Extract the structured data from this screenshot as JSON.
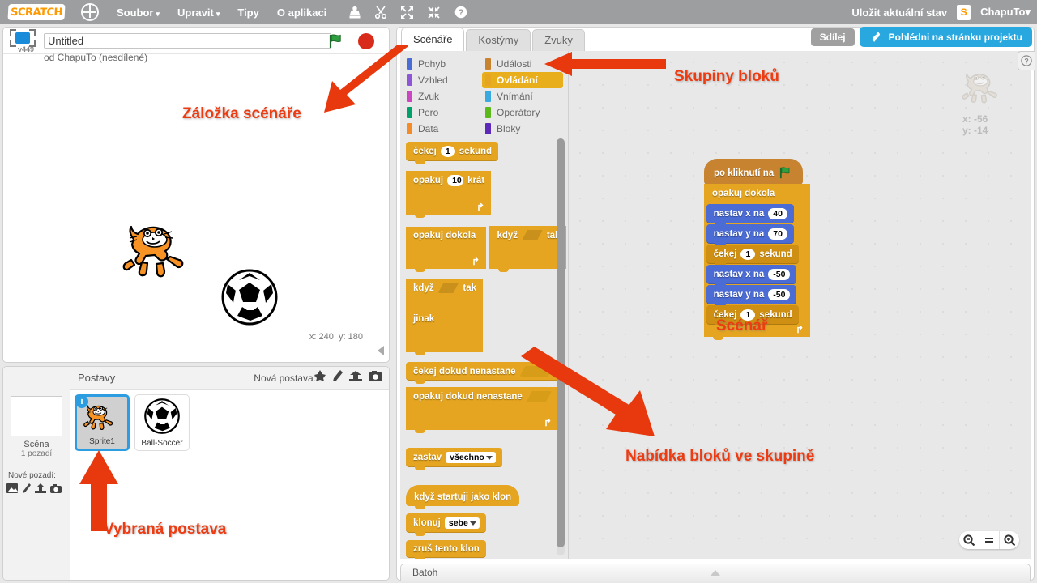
{
  "menubar": {
    "logo": "SCRATCH",
    "globe_icon": "globe-icon",
    "items": [
      {
        "label": "Soubor",
        "caret": "▾"
      },
      {
        "label": "Upravit",
        "caret": "▾"
      },
      {
        "label": "Tipy",
        "caret": ""
      },
      {
        "label": "O aplikaci",
        "caret": ""
      }
    ],
    "tool_icons": [
      "stamp-icon",
      "scissors-icon",
      "grow-icon",
      "shrink-icon",
      "help-icon"
    ],
    "save_label": "Uložit aktuální stav",
    "account_icon": "backpack-icon",
    "username": "ChapuTo",
    "username_caret": "▾"
  },
  "stage": {
    "version": "v449",
    "project_title_value": "Untitled",
    "project_title_placeholder": "Untitled",
    "byline": "od ChapuTo (nesdílené)",
    "green_flag": "green-flag-icon",
    "stop_button": "stop-icon",
    "coords_x_label": "x:",
    "coords_x_value": "240",
    "coords_y_label": "y:",
    "coords_y_value": "180"
  },
  "share": {
    "share_label": "Sdílej",
    "project_page_label": "Pohlédni na stránku projektu",
    "project_page_icon": "see-inside-icon"
  },
  "sprite_pane": {
    "header": "Postavy",
    "new_sprite_label": "Nová postava:",
    "new_sprite_icons": [
      "surprise-icon",
      "paint-icon",
      "upload-icon",
      "camera-icon"
    ],
    "stage_label": "Scéna",
    "stage_sublabel": "1 pozadí",
    "new_backdrop_label": "Nové pozadí:",
    "new_backdrop_icons": [
      "library-icon",
      "paint-icon",
      "upload-icon",
      "camera-icon"
    ],
    "sprites": [
      {
        "name": "Sprite1",
        "selected": true,
        "info_badge": "i",
        "thumb": "cat"
      },
      {
        "name": "Ball-Soccer",
        "selected": false,
        "info_badge": "",
        "thumb": "ball"
      }
    ]
  },
  "editor": {
    "tabs": [
      {
        "label": "Scénáře",
        "active": true
      },
      {
        "label": "Kostýmy",
        "active": false
      },
      {
        "label": "Zvuky",
        "active": false
      }
    ],
    "categories": [
      {
        "label": "Pohyb",
        "color": "#4b6cd4",
        "active": false,
        "col": 0,
        "row": 0
      },
      {
        "label": "Vzhled",
        "color": "#8e55d6",
        "active": false,
        "col": 0,
        "row": 1
      },
      {
        "label": "Zvuk",
        "color": "#ca47c1",
        "active": false,
        "col": 0,
        "row": 2
      },
      {
        "label": "Pero",
        "color": "#00a06a",
        "active": false,
        "col": 0,
        "row": 3
      },
      {
        "label": "Data",
        "color": "#f28b28",
        "active": false,
        "col": 0,
        "row": 4
      },
      {
        "label": "Události",
        "color": "#c88330",
        "active": false,
        "col": 1,
        "row": 0
      },
      {
        "label": "Ovládání",
        "color": "#e5a520",
        "active": true,
        "col": 1,
        "row": 1
      },
      {
        "label": "Vnímání",
        "color": "#39a9e0",
        "active": false,
        "col": 1,
        "row": 2
      },
      {
        "label": "Operátory",
        "color": "#5cb91b",
        "active": false,
        "col": 1,
        "row": 3
      },
      {
        "label": "Bloky",
        "color": "#5c29b8",
        "active": false,
        "col": 1,
        "row": 4
      }
    ],
    "palette_blocks": [
      {
        "type": "stack",
        "parts": [
          {
            "t": "text",
            "v": "čekej"
          },
          {
            "t": "num",
            "v": "1"
          },
          {
            "t": "text",
            "v": "sekund"
          }
        ]
      },
      {
        "type": "c",
        "parts": [
          {
            "t": "text",
            "v": "opakuj"
          },
          {
            "t": "num",
            "v": "10"
          },
          {
            "t": "text",
            "v": "krát"
          }
        ],
        "loop_arrow": true
      },
      {
        "type": "c",
        "parts": [
          {
            "t": "text",
            "v": "opakuj dokola"
          }
        ],
        "loop_arrow": true
      },
      {
        "type": "c",
        "parts": [
          {
            "t": "text",
            "v": "když"
          },
          {
            "t": "hex",
            "v": ""
          },
          {
            "t": "text",
            "v": "tak"
          }
        ],
        "loop_arrow": false
      },
      {
        "type": "ifelse",
        "parts": [
          {
            "t": "text",
            "v": "když"
          },
          {
            "t": "hex",
            "v": ""
          },
          {
            "t": "text",
            "v": "tak"
          }
        ],
        "else_label": "jinak"
      },
      {
        "type": "stack",
        "parts": [
          {
            "t": "text",
            "v": "čekej dokud nenastane"
          },
          {
            "t": "hexlite",
            "v": ""
          }
        ]
      },
      {
        "type": "c",
        "parts": [
          {
            "t": "text",
            "v": "opakuj dokud nenastane"
          },
          {
            "t": "hexlite",
            "v": ""
          }
        ],
        "loop_arrow": true
      },
      {
        "type": "stack",
        "parts": [
          {
            "t": "text",
            "v": "zastav"
          },
          {
            "t": "drop",
            "v": "všechno"
          }
        ],
        "capped": true
      },
      {
        "type": "hat",
        "parts": [
          {
            "t": "text",
            "v": "když startuji jako klon"
          }
        ]
      },
      {
        "type": "stack",
        "parts": [
          {
            "t": "text",
            "v": "klonuj"
          },
          {
            "t": "drop",
            "v": "sebe"
          }
        ]
      },
      {
        "type": "stack",
        "parts": [
          {
            "t": "text",
            "v": "zruš tento klon"
          }
        ],
        "capped": true
      }
    ],
    "script": {
      "hat": {
        "label": "po kliknutí na",
        "icon": "green-flag-icon"
      },
      "loop_label": "opakuj dokola",
      "body": [
        {
          "kind": "motion",
          "label": "nastav x na",
          "value": "40"
        },
        {
          "kind": "motion",
          "label": "nastav y na",
          "value": "70"
        },
        {
          "kind": "control",
          "label_pre": "čekej",
          "value": "1",
          "label_post": "sekund"
        },
        {
          "kind": "motion",
          "label": "nastav x na",
          "value": "-50"
        },
        {
          "kind": "motion",
          "label": "nastav y na",
          "value": "-50"
        },
        {
          "kind": "control",
          "label_pre": "čekej",
          "value": "1",
          "label_post": "sekund"
        }
      ]
    },
    "watermark": {
      "x_label": "x:",
      "x_value": "-56",
      "y_label": "y:",
      "y_value": "-14"
    },
    "zoom_controls": [
      {
        "icon": "zoom-out-icon",
        "glyph": "⊖"
      },
      {
        "icon": "zoom-reset-icon",
        "glyph": "="
      },
      {
        "icon": "zoom-in-icon",
        "glyph": "⊕"
      }
    ],
    "help_icon": "question-icon",
    "backpack_label": "Batoh"
  },
  "annotations": [
    {
      "text": "Záložka scénáře",
      "name": "annotation-scripts-tab"
    },
    {
      "text": "Skupiny bloků",
      "name": "annotation-block-groups"
    },
    {
      "text": "Scénář",
      "name": "annotation-script"
    },
    {
      "text": "Nabídka bloků ve skupině",
      "name": "annotation-block-menu"
    },
    {
      "text": "Vybraná postava",
      "name": "annotation-selected-sprite"
    }
  ],
  "colors": {
    "accent_orange": "#ef3b11",
    "control_yellow": "#e5a520",
    "motion_blue": "#4b6cd4",
    "events_brown": "#c88330",
    "share_blue": "#29a8e0"
  }
}
